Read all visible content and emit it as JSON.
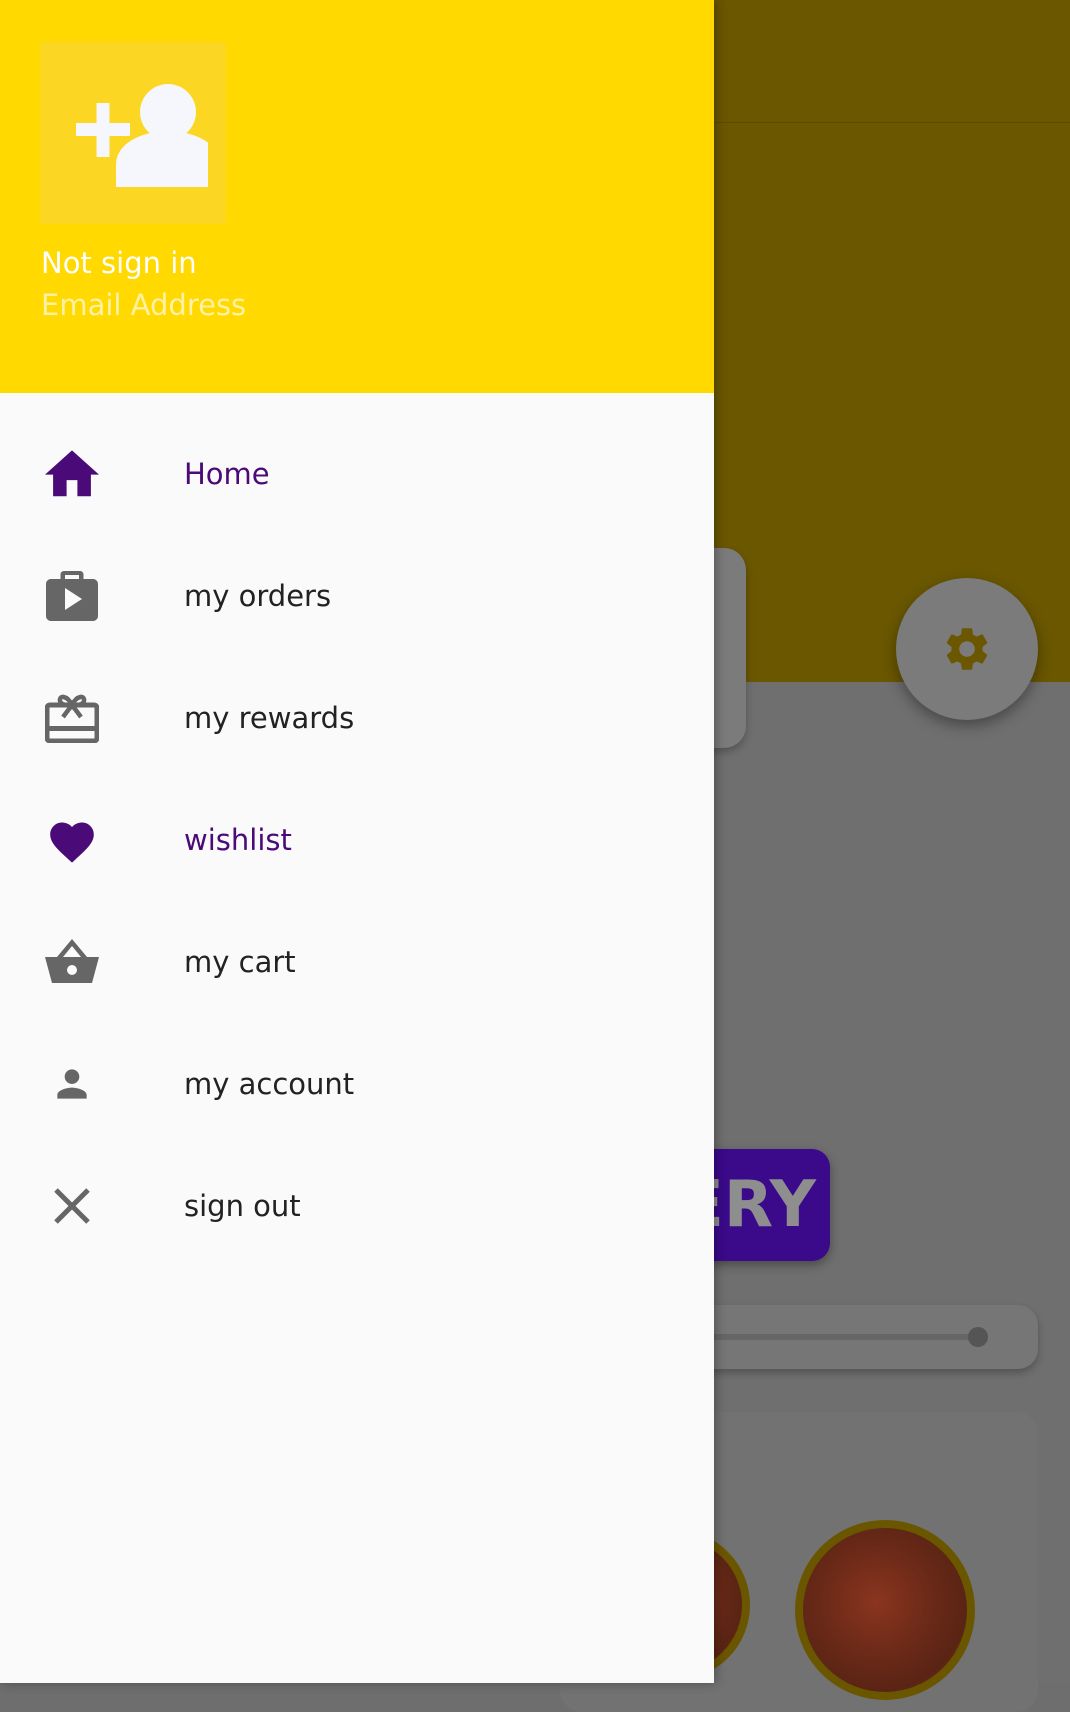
{
  "drawer": {
    "header": {
      "avatar_icon": "person-add-icon",
      "user_name": "Not sign in",
      "user_email": "Email Address",
      "background_color": "#ffd900"
    },
    "items": [
      {
        "label": "Home",
        "icon": "home-icon",
        "active": true
      },
      {
        "label": "my orders",
        "icon": "orders-icon",
        "active": false
      },
      {
        "label": "my rewards",
        "icon": "rewards-icon",
        "active": false
      },
      {
        "label": "wishlist",
        "icon": "heart-icon",
        "active": true
      },
      {
        "label": "my cart",
        "icon": "basket-icon",
        "active": false
      },
      {
        "label": "my account",
        "icon": "person-icon",
        "active": false
      },
      {
        "label": "sign out",
        "icon": "close-icon",
        "active": false
      }
    ],
    "accent_color": "#4a0a78",
    "icon_color": "#666666"
  },
  "background": {
    "banner_text": "ERY",
    "settings_icon": "gear-icon"
  }
}
